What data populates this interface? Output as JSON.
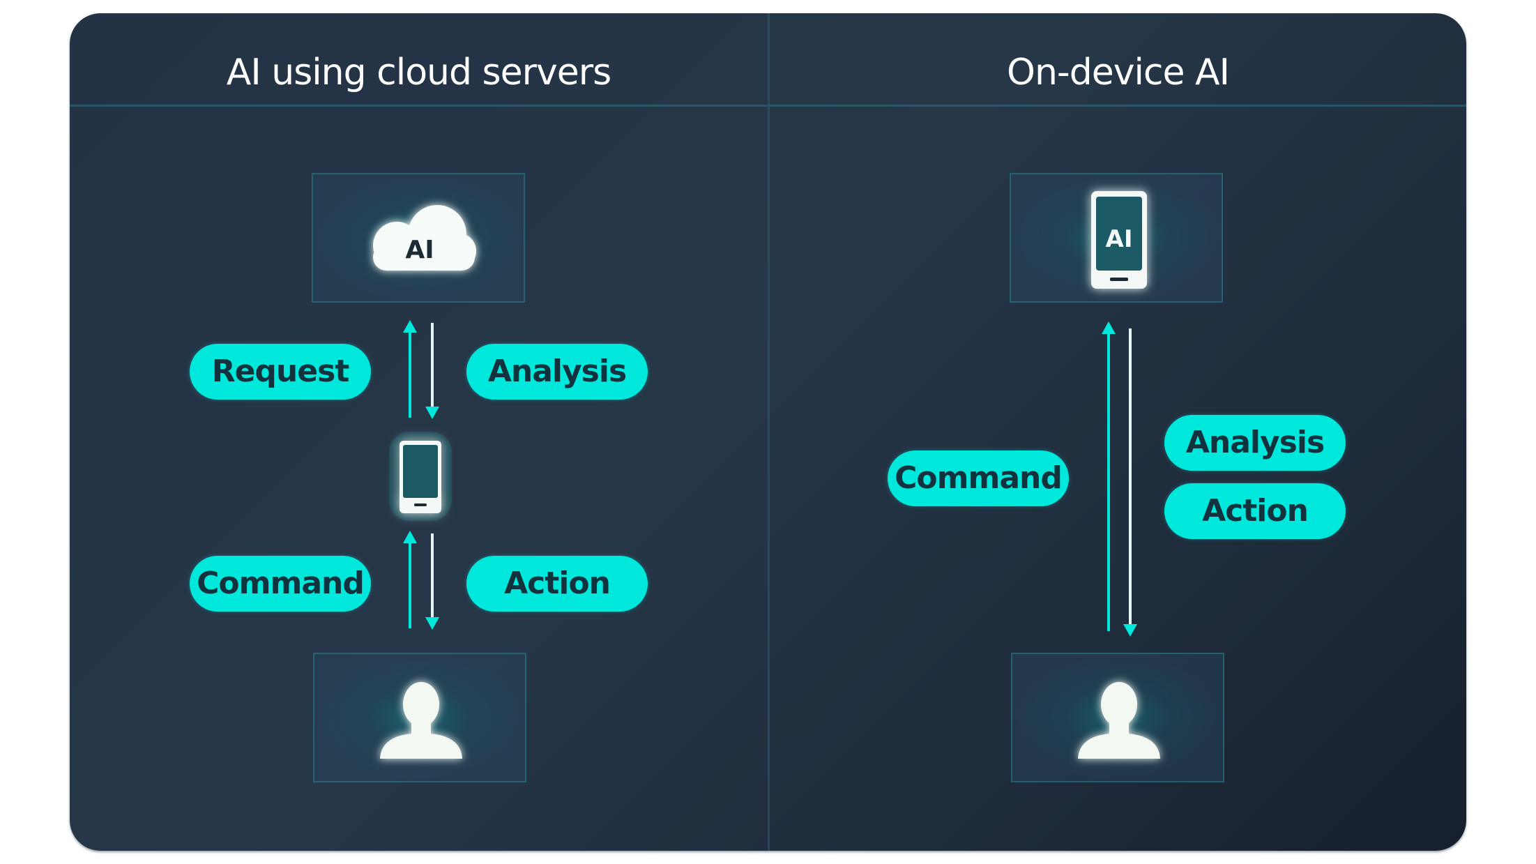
{
  "left_panel": {
    "title": "AI using cloud servers",
    "cloud_label": "AI",
    "pills": {
      "request": "Request",
      "analysis": "Analysis",
      "command": "Command",
      "action": "Action"
    }
  },
  "right_panel": {
    "title": "On-device AI",
    "phone_label": "AI",
    "pills": {
      "command": "Command",
      "analysis": "Analysis",
      "action": "Action"
    }
  },
  "colors": {
    "accent": "#00e8dc",
    "pill_text": "#12323e",
    "background": "#233244",
    "icon": "#f4f8f6"
  }
}
